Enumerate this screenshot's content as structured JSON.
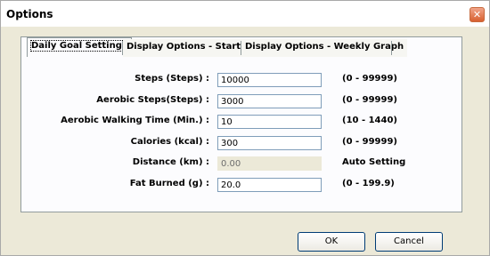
{
  "window": {
    "title": "Options",
    "close_glyph": "✕"
  },
  "tabs": [
    {
      "label": "Daily Goal Settings",
      "active": true
    },
    {
      "label": "Display Options - Startup",
      "active": false
    },
    {
      "label": "Display Options - Weekly Graph",
      "active": false
    }
  ],
  "rows": [
    {
      "label": "Steps (Steps) :",
      "value": "10000",
      "range": "(0 - 99999)",
      "enabled": true
    },
    {
      "label": "Aerobic Steps(Steps) :",
      "value": "3000",
      "range": "(0 - 99999)",
      "enabled": true
    },
    {
      "label": "Aerobic Walking Time (Min.) :",
      "value": "10",
      "range": "(10 - 1440)",
      "enabled": true
    },
    {
      "label": "Calories (kcal) :",
      "value": "300",
      "range": "(0 - 99999)",
      "enabled": true
    },
    {
      "label": "Distance (km) :",
      "value": "0.00",
      "range": "Auto Setting",
      "enabled": false
    },
    {
      "label": "Fat Burned (g) :",
      "value": "20.0",
      "range": "(0 - 199.9)",
      "enabled": true
    }
  ],
  "buttons": {
    "ok": "OK",
    "cancel": "Cancel"
  }
}
